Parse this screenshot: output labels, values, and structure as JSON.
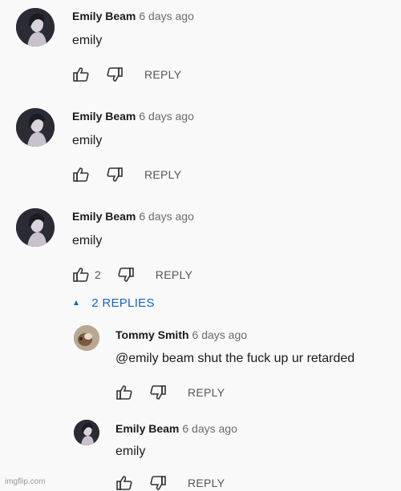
{
  "comments": [
    {
      "author": "Emily Beam",
      "time": "6 days ago",
      "text": "emily",
      "reply_label": "REPLY"
    },
    {
      "author": "Emily Beam",
      "time": "6 days ago",
      "text": "emily",
      "reply_label": "REPLY"
    },
    {
      "author": "Emily Beam",
      "time": "6 days ago",
      "text": "emily",
      "likes": "2",
      "reply_label": "REPLY"
    }
  ],
  "replies_toggle": {
    "label": "2 REPLIES",
    "icon": "caret-up-icon"
  },
  "replies": [
    {
      "author": "Tommy Smith",
      "time": "6 days ago",
      "text": "@emily beam shut the fuck up ur retarded",
      "reply_label": "REPLY"
    },
    {
      "author": "Emily Beam",
      "time": "6 days ago",
      "text": "emily",
      "reply_label": "REPLY"
    }
  ],
  "watermark": "imgflip.com",
  "colors": {
    "link_blue": "#1565c0",
    "meta_gray": "#6b6b6b"
  }
}
